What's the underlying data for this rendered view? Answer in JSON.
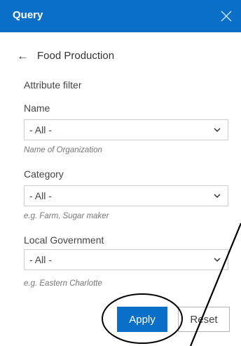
{
  "header": {
    "title": "Query",
    "close_icon": "close-icon",
    "background_color": "#0a6fc6"
  },
  "back": {
    "icon": "arrow-left-icon",
    "label": "Food Production"
  },
  "section_heading": "Attribute filter",
  "filters": [
    {
      "label": "Name",
      "selected": "- All -",
      "hint": "Name of Organization"
    },
    {
      "label": "Category",
      "selected": "- All -",
      "hint": "e.g. Farm, Sugar maker"
    },
    {
      "label": "Local Government",
      "selected": "- All -",
      "hint": "e.g. Eastern Charlotte"
    }
  ],
  "actions": {
    "apply_label": "Apply",
    "reset_label": "Reset"
  }
}
